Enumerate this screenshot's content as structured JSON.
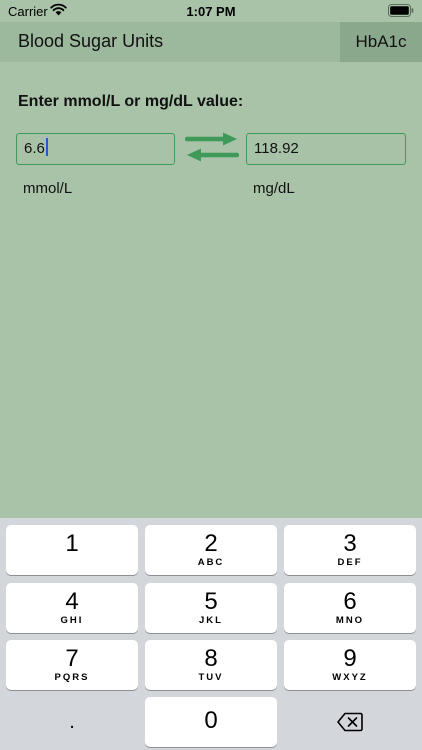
{
  "status_bar": {
    "carrier": "Carrier",
    "time": "1:07 PM"
  },
  "nav": {
    "title": "Blood Sugar Units",
    "tab_label": "HbA1c"
  },
  "main": {
    "prompt": "Enter mmol/L or mg/dL value:",
    "mmol_value": "6.6",
    "mgdl_value": "118.92",
    "mmol_unit": "mmol/L",
    "mgdl_unit": "mg/dL"
  },
  "keyboard": {
    "keys": [
      {
        "digit": "1",
        "letters": ""
      },
      {
        "digit": "2",
        "letters": "ABC"
      },
      {
        "digit": "3",
        "letters": "DEF"
      },
      {
        "digit": "4",
        "letters": "GHI"
      },
      {
        "digit": "5",
        "letters": "JKL"
      },
      {
        "digit": "6",
        "letters": "MNO"
      },
      {
        "digit": "7",
        "letters": "PQRS"
      },
      {
        "digit": "8",
        "letters": "TUV"
      },
      {
        "digit": "9",
        "letters": "WXYZ"
      }
    ],
    "decimal": ".",
    "zero": "0"
  },
  "icons": {
    "wifi": "wifi-icon",
    "battery": "battery-icon",
    "swap": "swap-arrows-icon",
    "delete": "delete-backspace-icon"
  },
  "colors": {
    "background": "#a9c3a9",
    "nav_background": "#9cb89d",
    "tab_background": "#8aa98c",
    "accent": "#3f9a5a",
    "caret": "#1f5bd9",
    "keyboard_background": "#d3d6db"
  }
}
